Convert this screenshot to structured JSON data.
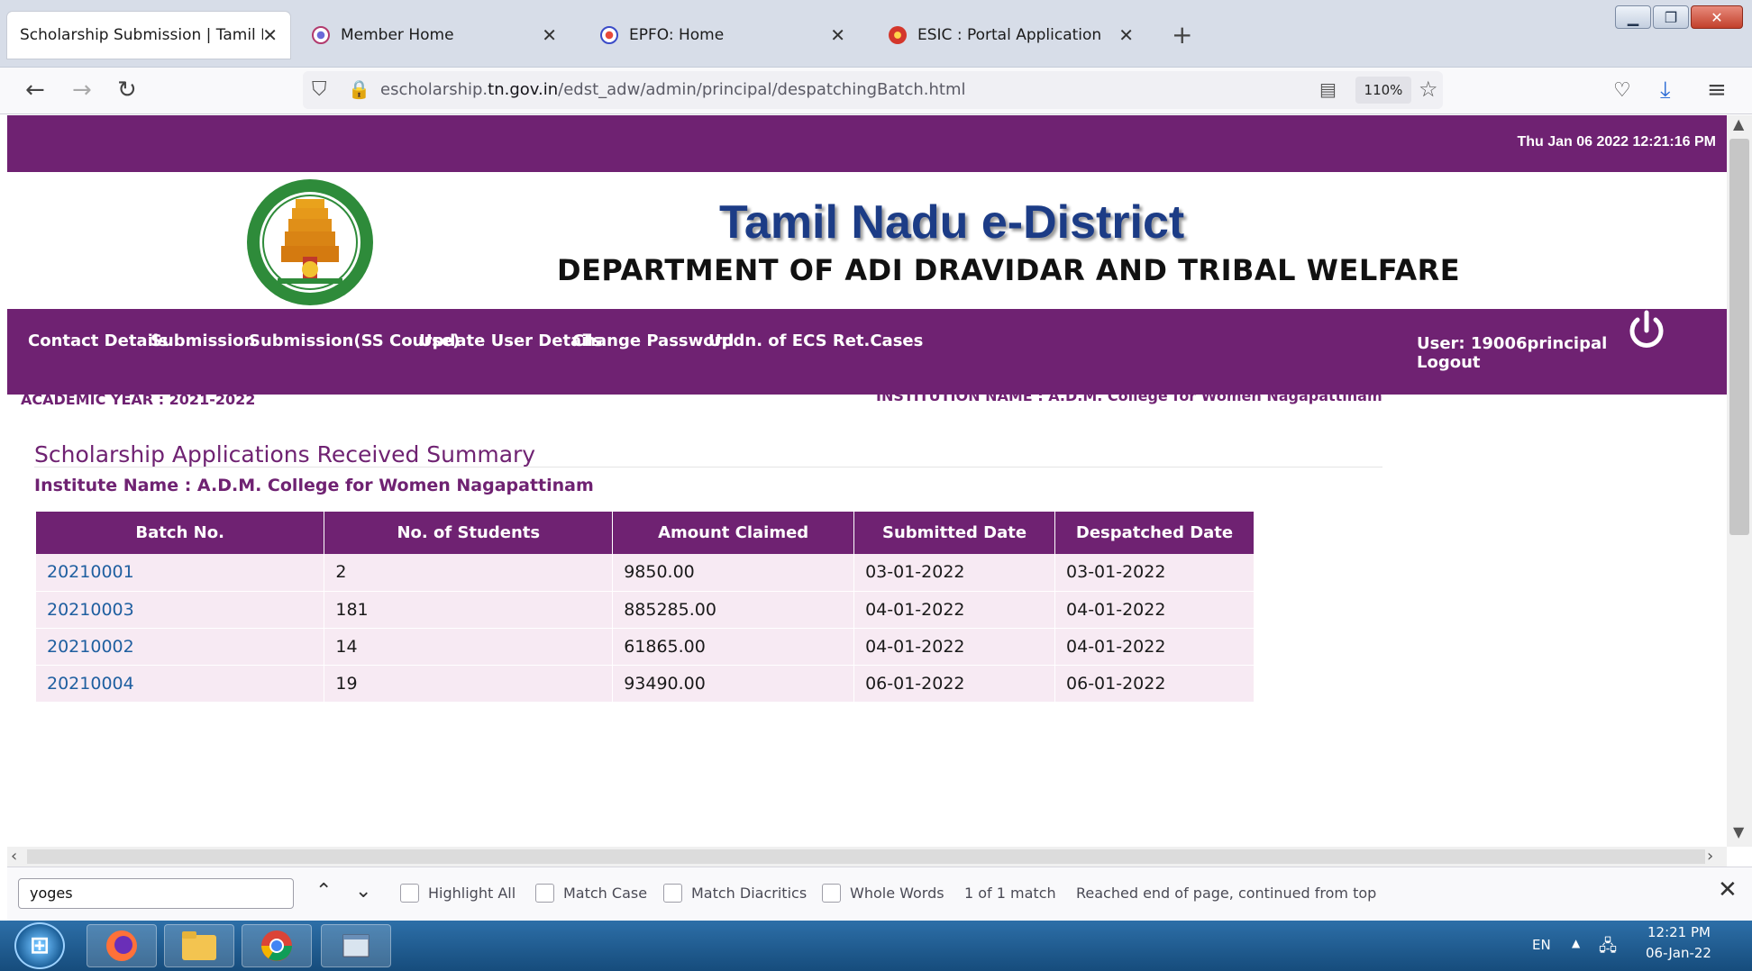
{
  "browser": {
    "tabs": [
      {
        "title": "Scholarship Submission | Tamil Nad",
        "active": true
      },
      {
        "title": "Member Home",
        "active": false
      },
      {
        "title": "EPFO: Home",
        "active": false
      },
      {
        "title": "ESIC : Portal Application",
        "active": false
      }
    ],
    "url_prefix": "escholarship.",
    "url_domain": "tn.gov.in",
    "url_path": "/edst_adw/admin/principal/despatchingBatch.html",
    "zoom": "110%"
  },
  "page": {
    "datetime": "Thu Jan 06 2022 12:21:16 PM",
    "site_title": "Tamil Nadu e-District",
    "dept_title": "DEPARTMENT OF ADI DRAVIDAR AND TRIBAL WELFARE",
    "menu": [
      "Contact Details",
      "Submission",
      "Submission(SS Course)",
      "Update User Details",
      "Change Password",
      "Updn. of ECS Ret.Cases"
    ],
    "user_label": "User: 19006principal",
    "logout_label": "Logout",
    "academic_year": "ACADEMIC YEAR : 2021-2022",
    "institution_heading": "INSTITUTION NAME : A.D.M. College for Women Nagapattinam",
    "summary_title": "Scholarship Applications Received Summary",
    "institute_line": "Institute Name : A.D.M. College for Women Nagapattinam",
    "table": {
      "columns": [
        "Batch No.",
        "No. of Students",
        "Amount Claimed",
        "Submitted Date",
        "Despatched Date"
      ],
      "rows": [
        [
          "20210001",
          "2",
          "9850.00",
          "03-01-2022",
          "03-01-2022"
        ],
        [
          "20210003",
          "181",
          "885285.00",
          "04-01-2022",
          "04-01-2022"
        ],
        [
          "20210002",
          "14",
          "61865.00",
          "04-01-2022",
          "04-01-2022"
        ],
        [
          "20210004",
          "19",
          "93490.00",
          "06-01-2022",
          "06-01-2022"
        ]
      ]
    }
  },
  "findbar": {
    "query": "yoges",
    "options": [
      "Highlight All",
      "Match Case",
      "Match Diacritics",
      "Whole Words"
    ],
    "match_count": "1 of 1 match",
    "status": "Reached end of page, continued from top"
  },
  "taskbar": {
    "language": "EN",
    "time": "12:21 PM",
    "date": "06-Jan-22"
  },
  "colors": {
    "brand_purple": "#6f2272",
    "title_blue": "#1c3c86",
    "link_blue": "#1f5fa0",
    "row_bg": "#f7eaf3"
  }
}
